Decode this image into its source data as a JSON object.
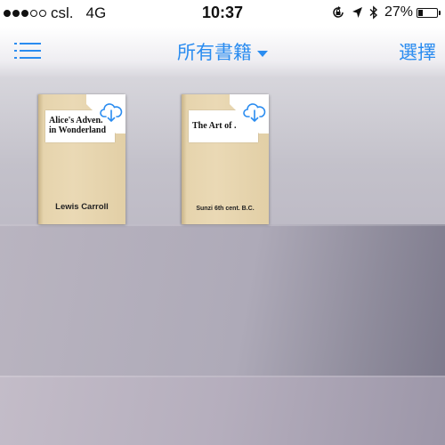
{
  "status_bar": {
    "carrier": "csl.",
    "network": "4G",
    "time": "10:37",
    "battery_percent": "27%",
    "battery_level": 0.27,
    "signal_dots_filled": 3,
    "signal_dots_total": 5,
    "icons": [
      "orientation-lock-icon",
      "location-arrow-icon",
      "bluetooth-icon",
      "battery-icon"
    ]
  },
  "nav": {
    "title": "所有書籍",
    "select_label": "選擇",
    "accent_color": "#2a8cf0",
    "icons": [
      "list-menu-icon",
      "caret-down-icon"
    ]
  },
  "books": [
    {
      "title": "Alice's Adven.\nin Wonderland",
      "author": "Lewis Carroll",
      "icon": "cloud-download-icon"
    },
    {
      "title": "The Art of .",
      "author": "Sunzi 6th cent. B.C.",
      "icon": "cloud-download-icon"
    }
  ]
}
